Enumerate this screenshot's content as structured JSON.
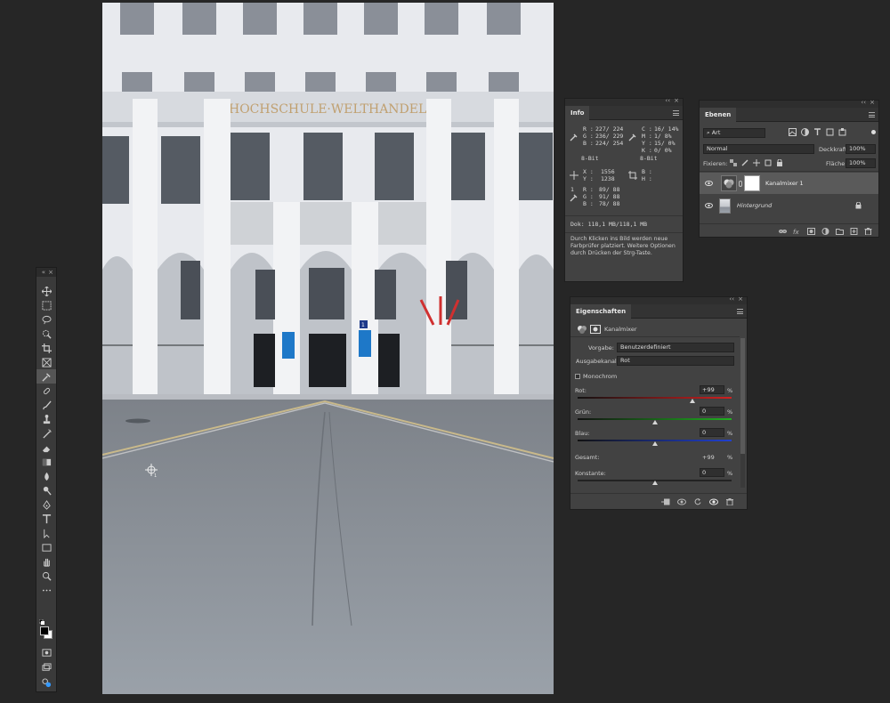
{
  "building_sign": "HOCHSCHULE·WELTHANDEL",
  "door_number": "1",
  "toolbar": {
    "collapse": "«",
    "close": "×",
    "tools": [
      "move-icon",
      "marquee-icon",
      "lasso-icon",
      "quick-select-icon",
      "crop-icon",
      "frame-icon",
      "eyedropper-icon",
      "healing-icon",
      "brush-icon",
      "clone-stamp-icon",
      "history-brush-icon",
      "eraser-icon",
      "gradient-icon",
      "blur-icon",
      "dodge-icon",
      "pen-icon",
      "type-icon",
      "path-select-icon",
      "rectangle-icon",
      "hand-icon",
      "zoom-icon",
      "more-icon"
    ]
  },
  "info": {
    "title": "Info",
    "collapse": "‹‹",
    "close": "×",
    "rgb_labels": [
      "R :",
      "G :",
      "B :"
    ],
    "rgb_values": [
      "227/ 224",
      "236/ 229",
      "224/ 254"
    ],
    "rgb_bit": "8-Bit",
    "cmyk_labels": [
      "C :",
      "M :",
      "Y :",
      "K :"
    ],
    "cmyk_values": [
      "16/ 14%",
      "1/ 8%",
      "15/ 0%",
      "0/ 0%"
    ],
    "cmyk_bit": "8-Bit",
    "xy_labels": [
      "X :",
      "Y :"
    ],
    "xy_values": [
      "1556",
      "1238"
    ],
    "wh_labels": [
      "B :",
      "H :"
    ],
    "sample_index": "1",
    "sample_labels": [
      "R :",
      "G :",
      "B :"
    ],
    "sample_values": [
      "89/ 88",
      "91/ 88",
      "78/ 88"
    ],
    "doc": "Dok: 118,1 MB/118,1 MB",
    "hint": "Durch Klicken ins Bild werden neue Farbprüfer platziert. Weitere Optionen durch Drücken der Strg-Taste."
  },
  "layers": {
    "title": "Ebenen",
    "collapse": "‹‹",
    "close": "×",
    "filter_kind": "Art",
    "blend_mode": "Normal",
    "opacity_label": "Deckkraft:",
    "opacity_value": "100%",
    "lock_label": "Fixieren:",
    "fill_label": "Fläche:",
    "fill_value": "100%",
    "items": [
      {
        "name": "Kanalmixer 1"
      },
      {
        "name": "Hintergrund"
      }
    ]
  },
  "properties": {
    "title": "Eigenschaften",
    "collapse": "‹‹",
    "close": "×",
    "adjustment_name": "Kanalmixer",
    "preset_label": "Vorgabe:",
    "preset_value": "Benutzerdefiniert",
    "output_label": "Ausgabekanal:",
    "output_value": "Rot",
    "monochrome_label": "Monochrom",
    "sliders": [
      {
        "label": "Rot:",
        "value": "+99",
        "unit": "%",
        "level": 99
      },
      {
        "label": "Grün:",
        "value": "0",
        "unit": "%",
        "level": 0
      },
      {
        "label": "Blau:",
        "value": "0",
        "unit": "%",
        "level": 0
      }
    ],
    "total_label": "Gesamt:",
    "total_value": "+99",
    "total_unit": "%",
    "constant_label": "Konstante:",
    "constant_value": "0",
    "constant_unit": "%",
    "constant_level": 0
  },
  "colors": {
    "panel_bg": "#424242",
    "app_bg": "#262626",
    "red_track": "#d02020",
    "green_track": "#20b020",
    "blue_track": "#2040d0"
  }
}
